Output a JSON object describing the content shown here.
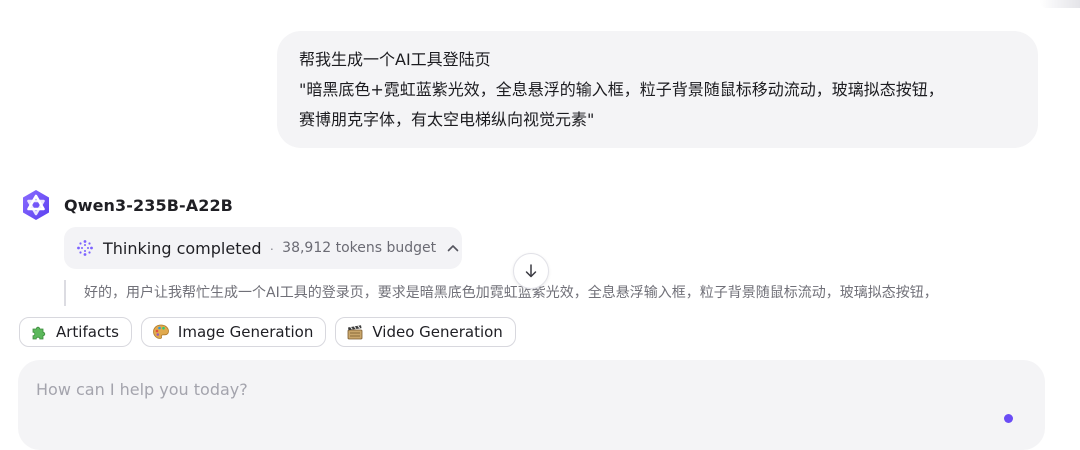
{
  "user_message": {
    "lines": [
      "帮我生成一个AI工具登陆页",
      "\"暗黑底色+霓虹蓝紫光效，全息悬浮的输入框，粒子背景随鼠标移动流动，玻璃拟态按钮，",
      "赛博朋克字体，有太空电梯纵向视觉元素\""
    ]
  },
  "assistant": {
    "model_name": "Qwen3-235B-A22B",
    "logo_icon": "qwen-logo-icon",
    "thinking": {
      "title": "Thinking completed",
      "separator": "·",
      "budget": "38,912 tokens budget",
      "icon": "sparkle-grid-icon",
      "toggle_icon": "chevron-up-icon"
    },
    "thought_preview": "好的，用户让我帮忙生成一个AI工具的登录页，要求是暗黑底色加霓虹蓝紫光效，全息悬浮输入框，粒子背景随鼠标流动，玻璃拟态按钮，"
  },
  "scroll_button": {
    "icon": "arrow-down-icon"
  },
  "chips": [
    {
      "label": "Artifacts",
      "icon": "puzzle-icon"
    },
    {
      "label": "Image Generation",
      "icon": "palette-icon"
    },
    {
      "label": "Video Generation",
      "icon": "film-clapper-icon"
    }
  ],
  "composer": {
    "placeholder": "How can I help you today?",
    "value": ""
  },
  "colors": {
    "accent": "#6a4cf5",
    "bubble_bg": "#f4f4f6",
    "muted_text": "#707078"
  }
}
